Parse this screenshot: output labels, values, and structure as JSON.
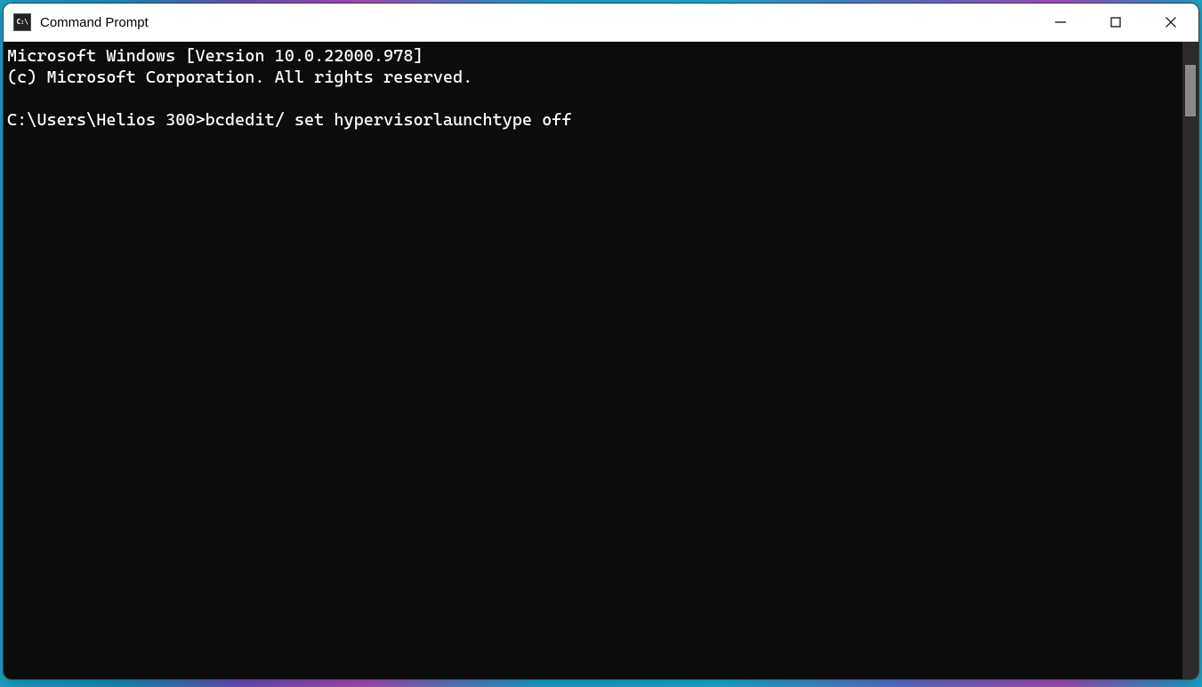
{
  "window": {
    "title": "Command Prompt",
    "app_icon_text": "C:\\"
  },
  "terminal": {
    "line1": "Microsoft Windows [Version 10.0.22000.978]",
    "line2": "(c) Microsoft Corporation. All rights reserved.",
    "blank": "",
    "prompt": "C:\\Users\\Helios 300>",
    "command": "bcdedit/ set hypervisorlaunchtype off"
  }
}
